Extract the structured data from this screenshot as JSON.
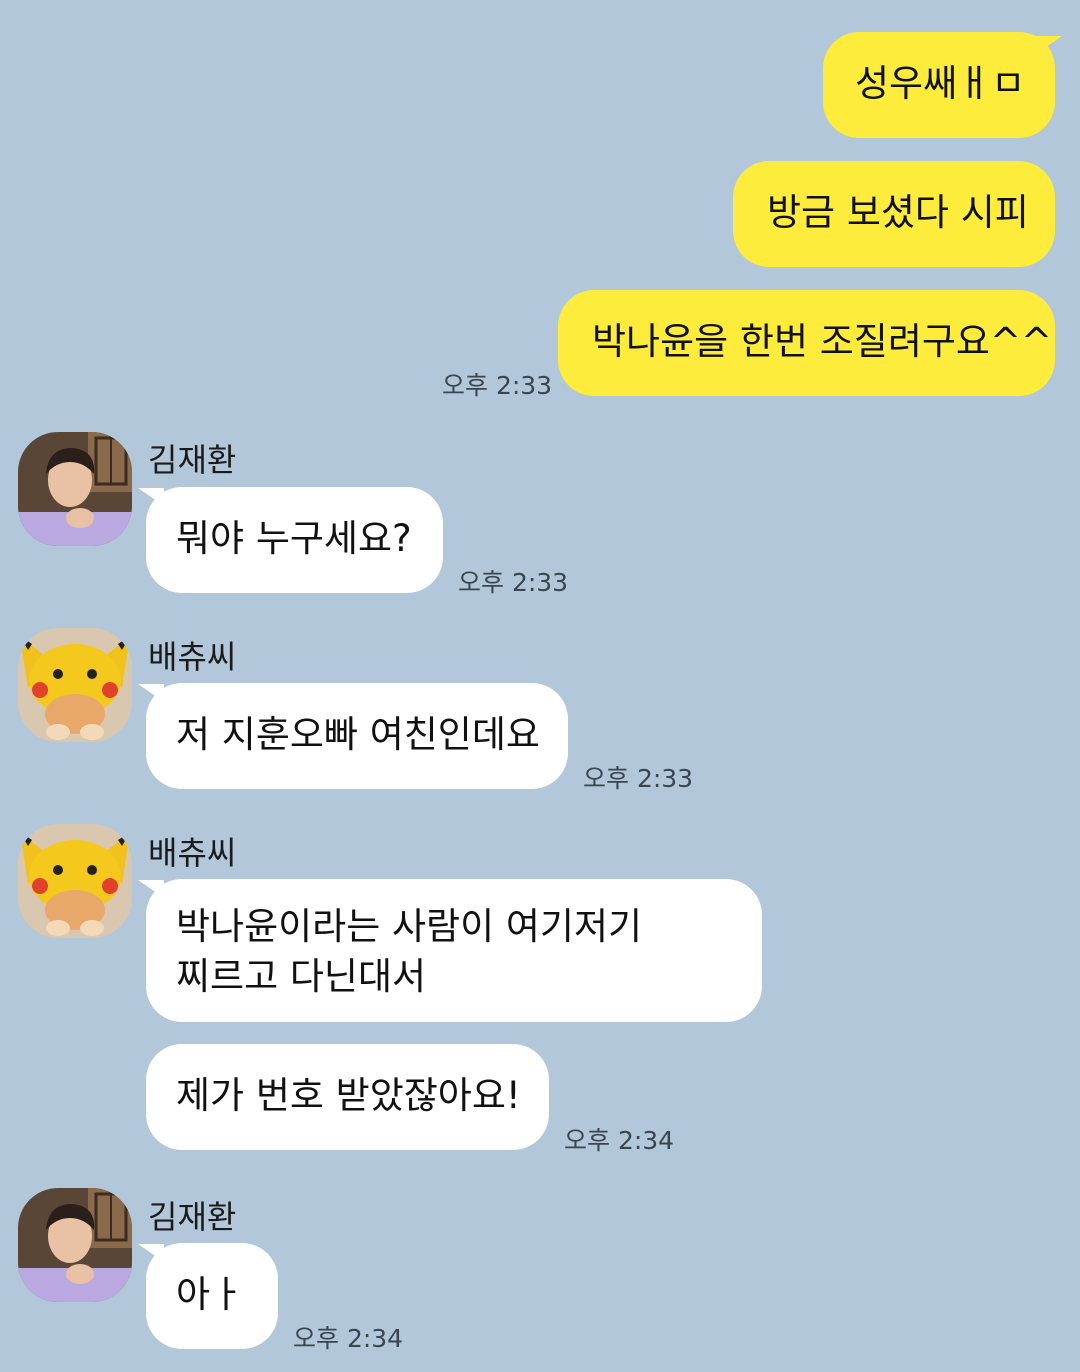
{
  "colors": {
    "background": "#b2c7da",
    "my_bubble": "#fdec3c",
    "other_bubble": "#ffffff"
  },
  "messages": {
    "m1": {
      "text": "성우쌔ㅐㅁ"
    },
    "m2": {
      "text": "방금 보셨다 시피"
    },
    "m3": {
      "text": "박나윤을 한번 조질려구요^^",
      "time": "오후 2:33"
    },
    "g1": {
      "sender": "김재환",
      "avatar": "boy-portrait-avatar",
      "text": "뭐야 누구세요?",
      "time": "오후 2:33"
    },
    "g2": {
      "sender": "배츄씨",
      "avatar": "pikachu-cat-avatar",
      "text": "저 지훈오빠 여친인데요",
      "time": "오후 2:33"
    },
    "g3": {
      "sender": "배츄씨",
      "avatar": "pikachu-cat-avatar",
      "line1": "박나윤이라는 사람이 여기저기",
      "line2": "찌르고 다닌대서",
      "text2": "제가 번호 받았잖아요!",
      "time": "오후 2:34"
    },
    "g4": {
      "sender": "김재환",
      "avatar": "boy-portrait-avatar",
      "text": "아ㅏ",
      "time": "오후 2:34"
    }
  }
}
